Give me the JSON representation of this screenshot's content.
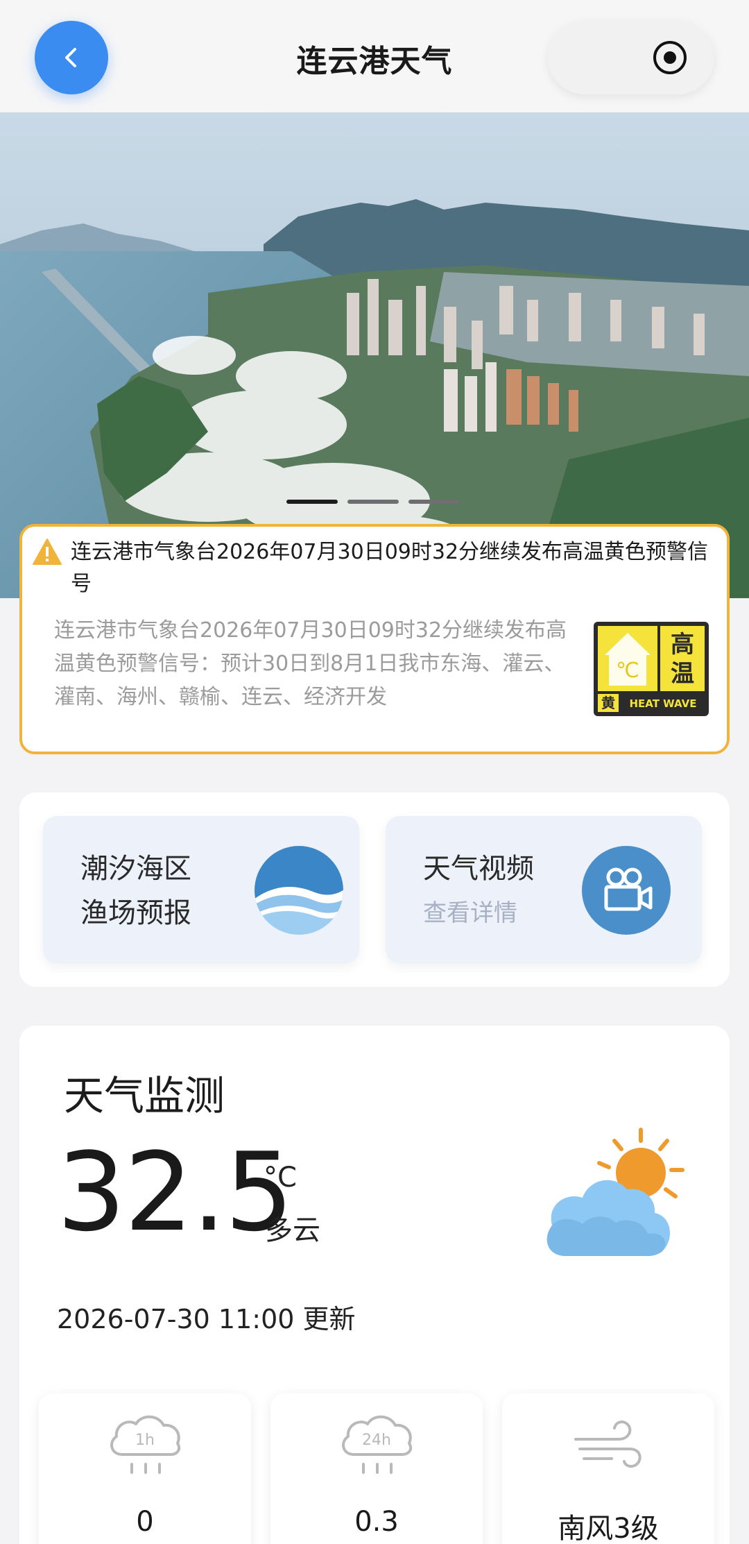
{
  "header": {
    "title": "连云港天气"
  },
  "banner": {
    "slide_count": 3,
    "active_slide": 1
  },
  "warning": {
    "title": "连云港市气象台2026年07月30日09时32分继续发布高温黄色预警信号",
    "body": "连云港市气象台2026年07月30日09时32分继续发布高温黄色预警信号：预计30日到8月1日我市东海、灌云、灌南、海州、赣榆、连云、经济开发",
    "badge": {
      "level_char": "黄",
      "type_chars": "高温",
      "unit": "℃",
      "english": "HEAT WAVE"
    },
    "colors": {
      "border": "#f0b43a",
      "badge_yellow": "#f5e33c",
      "badge_dark": "#2b2b2b"
    }
  },
  "links": [
    {
      "line1": "潮汐海区",
      "line2": "渔场预报",
      "icon": "wave-icon"
    },
    {
      "line1": "天气视频",
      "line2": "查看详情",
      "icon": "video-camera-icon"
    }
  ],
  "monitor": {
    "title": "天气监测",
    "temperature": "32.5",
    "unit": "°C",
    "condition": "多云",
    "icon": "partly-cloudy-icon",
    "update_time": "2026-07-30 11:00 更新",
    "stats": [
      {
        "icon": "rain-1h-icon",
        "icon_label": "1h",
        "value": "0"
      },
      {
        "icon": "rain-24h-icon",
        "icon_label": "24h",
        "value": "0.3"
      },
      {
        "icon": "wind-icon",
        "value": "南风3级"
      }
    ]
  },
  "colors": {
    "accent": "#3b8cf0",
    "tile_bg": "#edf1fa",
    "icon_blue": "#4a8fc9"
  }
}
